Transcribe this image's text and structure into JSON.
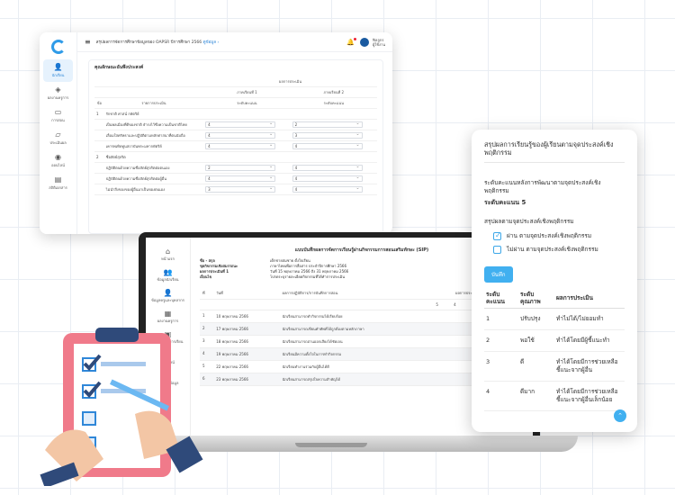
{
  "window1": {
    "title_prefix": "สรุปผลการจัดการศึกษาข้อมูลของ OAPSR ปีการศึกษา 2566",
    "title_link": "ดูข้อมูล ›",
    "user_name": "ฟิลลูกร",
    "user_role": "ผู้ใช้งาน",
    "nav": [
      {
        "icon": "person-icon",
        "glyph": "👤",
        "label": "นักเรียน"
      },
      {
        "icon": "layers-icon",
        "glyph": "◈",
        "label": "ผลงานครูการ"
      },
      {
        "icon": "book-icon",
        "glyph": "▭",
        "label": "การสอน"
      },
      {
        "icon": "folder-icon",
        "glyph": "▱",
        "label": "ประเมินผล"
      },
      {
        "icon": "location-icon",
        "glyph": "◉",
        "label": "ออนไลน์"
      },
      {
        "icon": "car-icon",
        "glyph": "▤",
        "label": "สถิติเอกสาร"
      }
    ],
    "section_title": "คุณลักษณะอันพึงประสงค์",
    "table_header_group": "ผลการประเมิน",
    "col_term1": "ภาคเรียนที่ 1",
    "col_term2": "ภาคเรียนที่ 2",
    "col_score": "ระดับคะแนน",
    "col_no": "ข้อ",
    "col_item": "รายการประเมิน",
    "rows": [
      {
        "no": "1",
        "text": "รักชาติ ศาสน์ กษัตริย์",
        "a": "",
        "b": "",
        "section": true
      },
      {
        "no": "",
        "text": "เป็นพลเมืองที่ดีของชาติ ธำรงไว้ซึ่งความเป็นชาติไทย",
        "a": "4",
        "b": "2",
        "section": false
      },
      {
        "no": "",
        "text": "เลื่อมใสศรัทธาและปฏิบัติตามหลักศาสนาที่ตนนับถือ",
        "a": "4",
        "b": "3",
        "section": false
      },
      {
        "no": "",
        "text": "เคารพเทิดทูนสถาบันพระมหากษัตริย์",
        "a": "4",
        "b": "4",
        "section": false
      },
      {
        "no": "2",
        "text": "ซื่อสัตย์สุจริต",
        "a": "",
        "b": "",
        "section": true
      },
      {
        "no": "",
        "text": "ปฏิบัติตนด้วยความซื่อสัตย์สุจริตต่อตนเอง",
        "a": "2",
        "b": "4",
        "section": false
      },
      {
        "no": "",
        "text": "ปฏิบัติตนด้วยความซื่อสัตย์สุจริตต่อผู้อื่น",
        "a": "4",
        "b": "4",
        "section": false
      },
      {
        "no": "",
        "text": "ไม่นำสิ่งของของผู้อื่นมาเป็นของตนเอง",
        "a": "3",
        "b": "4",
        "section": false
      }
    ]
  },
  "laptop": {
    "nav": [
      {
        "icon": "home-icon",
        "glyph": "⌂",
        "label": "หน้าแรก"
      },
      {
        "icon": "users-icon",
        "glyph": "👥",
        "label": "ข้อมูลนักเรียน"
      },
      {
        "icon": "teacher-icon",
        "glyph": "👤",
        "label": "ข้อมูลครูและบุคลากร"
      },
      {
        "icon": "grid-icon",
        "glyph": "▦",
        "label": "ผลงานครูการ"
      },
      {
        "icon": "calendar-icon",
        "glyph": "▣",
        "label": "ประเมินผลการเรียน"
      },
      {
        "icon": "location-icon",
        "glyph": "◉",
        "label": "ออนไลน์"
      },
      {
        "icon": "car-icon",
        "glyph": "▤",
        "label": "รายงานข้อมูล"
      }
    ],
    "title": "แบบบันทึกผลการจัดการเรียนรู้ผ่านกิจกรรมการสอนเสริมทักษะ (SIP)",
    "info": [
      {
        "k": "ชื่อ - สกุล",
        "v": "เด็กชายสมชาย ตั้งใจเรียน"
      },
      {
        "k": "ชุดกิจกรรมเชิงสมรรถนะ",
        "v": "ภาษาไทยเพื่อการสื่อสาร ประจำปีการศึกษา 2566"
      },
      {
        "k": "ผลการประเมินที่ 1",
        "v": "วันที่ 15 พฤษภาคม 2566 ถึง 31 พฤษภาคม 2566"
      },
      {
        "k": "เงื่อนไข",
        "v": "โปรดระบุรายละเอียดกิจกรรมที่ได้ทำการประเมิน"
      }
    ],
    "col_no": "ที่",
    "col_date": "วันที่",
    "col_activity": "ผลการปฏิบัติการ/การบันทึกการสอน",
    "col_scale": "ผลการประเมินความเหมาะสม",
    "scale": [
      "5",
      "4",
      "3",
      "2",
      "1"
    ],
    "rows": [
      {
        "no": "1",
        "date": "10 พฤษภาคม 2566",
        "text": "นักเรียนสามารถทำกิจกรรมได้เรียบร้อย"
      },
      {
        "no": "2",
        "date": "17 พฤษภาคม 2566",
        "text": "นักเรียนสามารถเขียนคำศัพท์ได้ถูกต้องตามหลักภาษา"
      },
      {
        "no": "3",
        "date": "18 พฤษภาคม 2566",
        "text": "นักเรียนสามารถอ่านออกเสียงได้ชัดเจน"
      },
      {
        "no": "4",
        "date": "19 พฤษภาคม 2566",
        "text": "นักเรียนมีความตั้งใจในการทำกิจกรรม"
      },
      {
        "no": "5",
        "date": "22 พฤษภาคม 2566",
        "text": "นักเรียนทำงานร่วมกับผู้อื่นได้ดี"
      },
      {
        "no": "6",
        "date": "23 พฤษภาคม 2566",
        "text": "นักเรียนสามารถสรุปใจความสำคัญได้"
      }
    ]
  },
  "phone": {
    "title": "สรุปผลการเรียนรู้ของผู้เรียนตามจุดประสงค์เชิงพฤติกรรม",
    "desc": "ระดับคะแนนหลังการพัฒนาตามจุดประสงค์เชิงพฤติกรรม",
    "level": "ระดับคะแนน 5",
    "question": "สรุปผลตามจุดประสงค์เชิงพฤติกรรม",
    "opt_pass": "ผ่าน ตามจุดประสงค์เชิงพฤติกรรม",
    "opt_fail": "ไม่ผ่าน ตามจุดประสงค์เชิงพฤติกรรม",
    "save_label": "บันทึก",
    "col_score": "ระดับคะแนน",
    "col_quality": "ระดับคุณภาพ",
    "col_result": "ผลการประเมิน",
    "rows": [
      {
        "score": "1",
        "quality": "ปรับปรุง",
        "result": "ทำไม่ได้/ไม่ยอมทำ"
      },
      {
        "score": "2",
        "quality": "พอใช้",
        "result": "ทำได้โดยมีผู้ชี้แนะทำ"
      },
      {
        "score": "3",
        "quality": "ดี",
        "result": "ทำได้โดยมีการช่วยเหลือ ชี้แนะจากผู้อื่น"
      },
      {
        "score": "4",
        "quality": "ดีมาก",
        "result": "ทำได้โดยมีการช่วยเหลือ ชี้แนะจากผู้อื่นเล็กน้อย"
      }
    ]
  },
  "colors": {
    "accent": "#41b0f0",
    "brand_blue": "#2f87d8"
  }
}
